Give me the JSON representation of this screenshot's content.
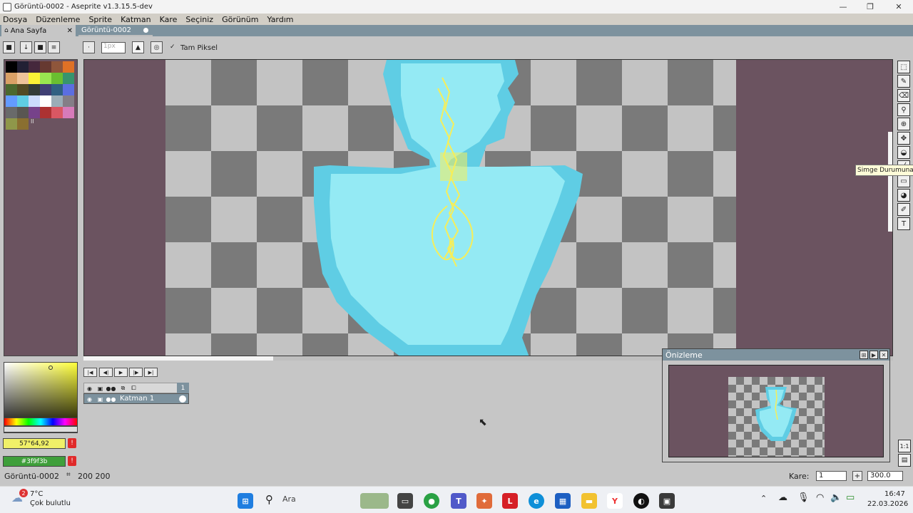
{
  "window": {
    "title": "Görüntü-0002 - Aseprite v1.3.15.5-dev",
    "minimize": "—",
    "maximize": "❐",
    "close": "✕"
  },
  "menu": [
    "Dosya",
    "Düzenleme",
    "Sprite",
    "Katman",
    "Kare",
    "Seçiniz",
    "Görünüm",
    "Yardım"
  ],
  "tabs": [
    {
      "label": "Ana Sayfa",
      "close": "✕"
    },
    {
      "label": "Görüntü-0002"
    }
  ],
  "context_bar": {
    "brush_size": "1px",
    "pixel_perfect_label": "Tam Piksel",
    "pixel_perfect_check": "✓"
  },
  "palette": {
    "colors": [
      "#000000",
      "#222034",
      "#45283c",
      "#663931",
      "#8f563b",
      "#df7126",
      "#d9a066",
      "#eec39a",
      "#fbf236",
      "#99e550",
      "#6abe30",
      "#37946e",
      "#4b692f",
      "#524b24",
      "#323c39",
      "#3f3f74",
      "#306082",
      "#5b6ee1",
      "#639bff",
      "#5fcde4",
      "#cbdbfc",
      "#ffffff",
      "#9badb7",
      "#847e87",
      "#696a6a",
      "#595652",
      "#76428a",
      "#ac3232",
      "#d95763",
      "#d77bba",
      "#8f974a",
      "#8a6f30"
    ],
    "index_marker": "II"
  },
  "colors": {
    "foreground_label": "57°64,92",
    "background_label": "#3f9f3b",
    "warning_icon": "!"
  },
  "tooltip": "Simge Durumuna",
  "timeline": {
    "frame_number": "1",
    "layer_name": "Katman 1"
  },
  "preview": {
    "title": "Önizleme"
  },
  "status": {
    "file_name": "Görüntü-0002",
    "size": "200 200",
    "frame_label": "Kare:",
    "frame_value": "1",
    "zoom": "300.0"
  },
  "taskbar": {
    "weather_temp": "7°C",
    "weather_desc": "Çok bulutlu",
    "weather_badge": "2",
    "search_label": "Ara",
    "time": "16:47",
    "date": "22.03.2026"
  }
}
